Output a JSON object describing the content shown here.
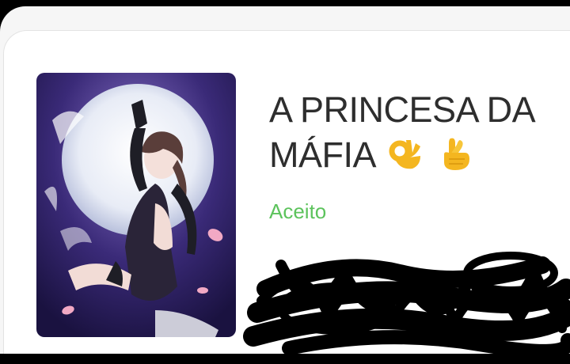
{
  "story": {
    "title": "A PRINCESA DA MÁFIA",
    "title_line1": "A PRINCESA DA",
    "title_line2": "MÁFIA",
    "title_emojis": [
      "ok-hand-icon",
      "crossed-fingers-icon"
    ],
    "status": "Aceito",
    "status_color": "#5cc35c",
    "cover": "anime-girl-with-pistol-moon-cover"
  },
  "colors": {
    "title": "#2e2e2e",
    "card_background": "#ffffff",
    "redaction": "#000000"
  }
}
